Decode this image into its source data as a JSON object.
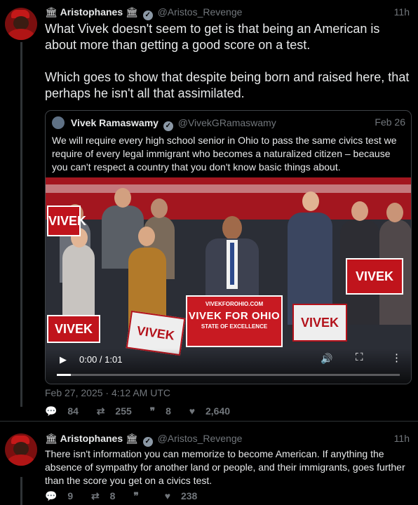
{
  "tweet1": {
    "name": "Aristophanes",
    "handle": "@Aristos_Revenge",
    "time": "11h",
    "paragraphs": [
      "What Vivek doesn't seem to get is that being an American is about more than getting a good score on a test.",
      "Which goes to show that despite being born and raised here, that perhaps he isn't all that assimilated."
    ],
    "date": "Feb 27, 2025 · 4:12 AM UTC",
    "replies": "84",
    "retweets": "255",
    "quotes": "8",
    "likes": "2,640"
  },
  "quote": {
    "name": "Vivek Ramaswamy",
    "handle": "@VivekGRamaswamy",
    "date": "Feb 26",
    "text": "We will require every high school senior in Ohio to pass the same civics test we require of every legal immigrant who becomes a naturalized citizen – because you can't respect a country that you don't know basic things about.",
    "video": {
      "time": "0:00 / 1:01",
      "progress": 0.04,
      "podium_url": "VIVEKFOROHIO.COM",
      "podium_main": "VIVEK FOR OHIO",
      "podium_sub": "STATE OF EXCELLENCE",
      "sign_text": "VIVEK"
    }
  },
  "tweet2": {
    "name": "Aristophanes",
    "handle": "@Aristos_Revenge",
    "time": "11h",
    "text": "There isn't information you can memorize to become American. If anything the absence of sympathy for another land or people, and their immigrants, goes further than the score you get on a civics test.",
    "replies": "9",
    "retweets": "8",
    "quotes": "",
    "likes": "238"
  },
  "icons": {
    "reply": "comment-icon",
    "retweet": "retweet-icon",
    "quote": "quote-icon",
    "like": "heart-icon"
  },
  "colors": {
    "background": "#000000",
    "text": "#e7e9ea",
    "muted": "#71767b",
    "border": "#2f3336",
    "campaign_red": "#c81a22"
  }
}
